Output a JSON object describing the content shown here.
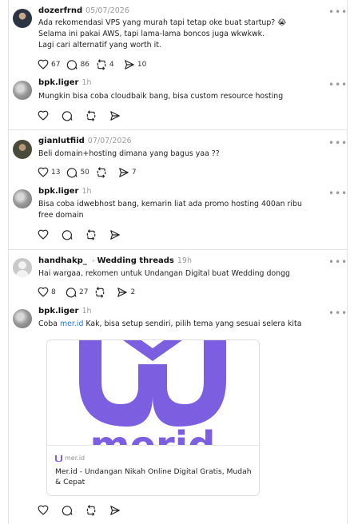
{
  "colors": {
    "link": "#1877f2",
    "muted": "#9a9a9a",
    "brand_purple": "#7b5fe0"
  },
  "posts": [
    {
      "username": "dozerfrnd",
      "time": "05/07/2026",
      "text_lines": [
        "Ada rekomendasi VPS yang murah tapi tetap oke buat startup? 😭",
        "Selama ini pakai AWS, tapi lama-lama boncos juga wkwkwk.",
        "Lagi cari alternatif yang worth it."
      ],
      "likes": "67",
      "comments": "86",
      "reposts": "4",
      "shares": "10"
    },
    {
      "username": "bpk.liger",
      "time": "1h",
      "text_lines": [
        "Mungkin bisa coba cloudbaik bang, bisa custom resource hosting"
      ]
    },
    {
      "username": "gianlutfiid",
      "time": "07/07/2026",
      "text_lines": [
        "Beli domain+hosting dimana yang bagus yaa ??"
      ],
      "likes": "13",
      "comments": "50",
      "reposts": "",
      "shares": "7"
    },
    {
      "username": "bpk.liger",
      "time": "1h",
      "text_lines": [
        "Bisa coba idwebhost bang, kemarin liat ada promo hosting 400an ribu",
        "free domain"
      ]
    },
    {
      "username": "handhakp_",
      "thread": "Wedding threads",
      "time": "19h",
      "text_lines": [
        "Hai wargaa, rekomen untuk Undangan Digital buat Wedding dongg"
      ],
      "likes": "8",
      "comments": "27",
      "reposts": "",
      "shares": "2"
    },
    {
      "username": "bpk.liger",
      "time": "1h",
      "text_before_link": "Coba ",
      "link_text": "mer.id",
      "text_after_link": " Kak, bisa setup sendiri, pilih tema yang sesuai selera kita",
      "card": {
        "image_text": "merid",
        "domain": "mer.id",
        "title": "Mer.id - Undangan Nikah Online Digital Gratis, Mudah & Cepat"
      }
    }
  ],
  "icons": {
    "like": "heart-icon",
    "comment": "comment-icon",
    "repost": "repost-icon",
    "share": "send-icon",
    "more": "more-icon"
  }
}
